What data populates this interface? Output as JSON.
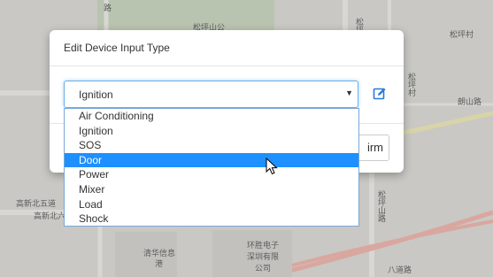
{
  "map": {
    "labels": [
      {
        "text": "松坪山公",
        "cls": ""
      },
      {
        "text": "松坪村",
        "cls": ""
      },
      {
        "text": "高新北五道",
        "cls": ""
      },
      {
        "text": "高新北六",
        "cls": ""
      },
      {
        "text": "朗山路",
        "cls": ""
      },
      {
        "text": "清华信息",
        "cls": ""
      },
      {
        "text": "港",
        "cls": ""
      },
      {
        "text": "环胜电子",
        "cls": ""
      },
      {
        "text": "深圳有限",
        "cls": ""
      },
      {
        "text": "公司",
        "cls": ""
      },
      {
        "text": "松坪山路",
        "cls": "v"
      },
      {
        "text": "松坪",
        "cls": "v"
      },
      {
        "text": "松坪村",
        "cls": "v"
      },
      {
        "text": "八道路",
        "cls": ""
      },
      {
        "text": "路",
        "cls": ""
      }
    ]
  },
  "modal": {
    "title": "Edit Device Input Type",
    "select": {
      "value": "Ignition",
      "caret": "▼"
    },
    "confirm_label": "irm"
  },
  "dropdown": {
    "options": [
      "Air Conditioning",
      "Ignition",
      "SOS",
      "Door",
      "Power",
      "Mixer",
      "Load",
      "Shock"
    ],
    "highlighted": "Door"
  },
  "colors": {
    "highlight": "#1e90ff",
    "focus_border": "#66afe9",
    "icon": "#2a7ad6"
  }
}
